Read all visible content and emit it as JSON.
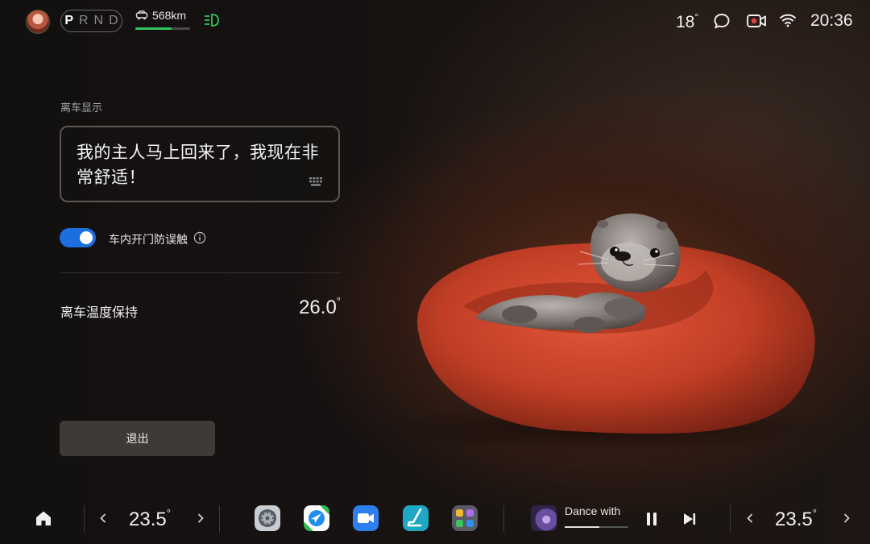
{
  "status_bar": {
    "gears": [
      "P",
      "R",
      "N",
      "D"
    ],
    "active_gear": "P",
    "range": "568km",
    "range_level": 0.66,
    "outside_temp": "18",
    "outside_temp_unit": "°",
    "time": "20:36",
    "icons": [
      "avatar",
      "car-icon",
      "headlight-icon",
      "chat-icon",
      "record-icon",
      "wifi-icon"
    ]
  },
  "panel": {
    "section_label": "离车显示",
    "message": "我的主人马上回来了，我现在非常舒适！",
    "toggle_on": true,
    "toggle_label": "车内开门防误触",
    "keep_temp_label": "离车温度保持",
    "keep_temp_value": "26.0",
    "keep_temp_unit": "°",
    "exit_label": "退出"
  },
  "dock": {
    "left_temp": "23.5",
    "right_temp": "23.5",
    "temp_unit": "°",
    "apps": [
      "settings-icon",
      "navigation-icon",
      "video-call-icon",
      "seat-icon",
      "app-grid-icon"
    ],
    "media_title": "Dance with",
    "media_progress": 0.55
  },
  "colors": {
    "accent": "#1c6fe0",
    "range_bar": "#2fc55a",
    "headlight": "#2fc55a",
    "record": "#e8414b"
  }
}
